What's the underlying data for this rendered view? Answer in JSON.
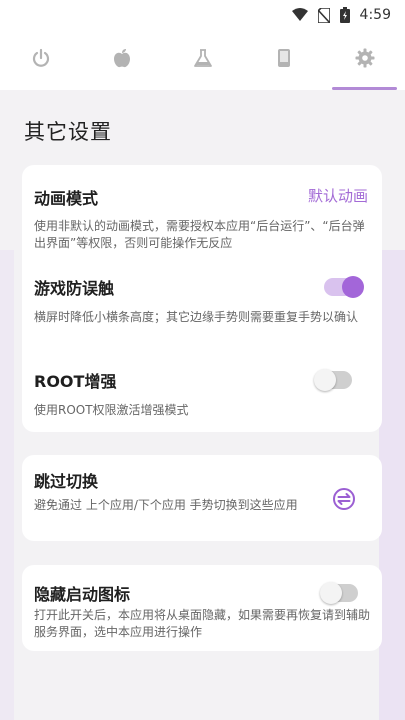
{
  "status_bar": {
    "time": "4:59",
    "icons": [
      "wifi-icon",
      "no-sim-icon",
      "battery-charging-icon"
    ]
  },
  "tabs": [
    {
      "icon": "power-icon",
      "active": false
    },
    {
      "icon": "apple-icon",
      "active": false
    },
    {
      "icon": "flask-icon",
      "active": false
    },
    {
      "icon": "phone-icon",
      "active": false
    },
    {
      "icon": "gear-icon",
      "active": true
    }
  ],
  "page": {
    "title": "其它设置"
  },
  "colors": {
    "accent": "#a366d9",
    "accent_light": "#d9c2ee",
    "background": "#f3f2f4"
  },
  "card1": {
    "animation_mode": {
      "title": "动画模式",
      "value": "默认动画",
      "desc": "使用非默认的动画模式，需要授权本应用“后台运行”、“后台弹出界面”等权限，否则可能操作无反应"
    },
    "game_protect": {
      "title": "游戏防误触",
      "toggle": true,
      "desc": "横屏时降低小横条高度；其它边缘手势则需要重复手势以确认"
    },
    "root_enhance": {
      "title": "ROOT增强",
      "toggle": false,
      "desc": "使用ROOT权限激活增强模式"
    }
  },
  "card2": {
    "skip_switch": {
      "title": "跳过切换",
      "desc": "避免通过 上个应用/下个应用 手势切换到这些应用"
    }
  },
  "card3": {
    "hide_icon": {
      "title": "隐藏启动图标",
      "toggle": false,
      "desc": "打开此开关后，本应用将从桌面隐藏，如果需要再恢复请到辅助服务界面，选中本应用进行操作"
    }
  }
}
